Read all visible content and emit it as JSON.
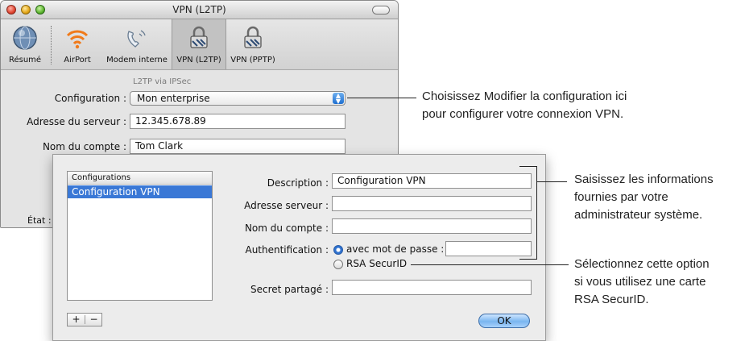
{
  "window": {
    "title": "VPN (L2TP)",
    "toolbar": [
      {
        "label": "Résumé",
        "icon": "globe-icon"
      },
      {
        "label": "AirPort",
        "icon": "airport-icon"
      },
      {
        "label": "Modem interne",
        "icon": "modem-icon"
      },
      {
        "label": "VPN (L2TP)",
        "icon": "lock-icon",
        "selected": true
      },
      {
        "label": "VPN (PPTP)",
        "icon": "lock-icon"
      }
    ],
    "sublabel": "L2TP via IPSec",
    "config_label": "Configuration :",
    "config_value": "Mon enterprise",
    "server_label": "Adresse du serveur :",
    "server_value": "12.345.678.89",
    "account_label": "Nom du compte :",
    "account_value": "Tom Clark",
    "status_label": "État :"
  },
  "sheet": {
    "list_header": "Configurations",
    "list_items": [
      "Configuration  VPN"
    ],
    "description_label": "Description :",
    "description_value": "Configuration  VPN",
    "server_label": "Adresse serveur :",
    "server_value": "",
    "account_label": "Nom du compte :",
    "account_value": "",
    "auth_label": "Authentification :",
    "auth_password_option": "avec mot de passe :",
    "auth_password_value": "",
    "auth_rsa_option": "RSA SecurID",
    "secret_label": "Secret partagé :",
    "secret_value": "",
    "add_label": "+",
    "remove_label": "−",
    "ok_label": "OK"
  },
  "callouts": {
    "config": [
      "Choisissez Modifier la configuration ici",
      "pour configurer votre connexion VPN."
    ],
    "fields": [
      "Saisissez les informations",
      "fournies par votre",
      "administrateur système."
    ],
    "rsa": [
      "Sélectionnez cette option",
      "si vous utilisez une carte",
      "RSA SecurID."
    ]
  },
  "colors": {
    "selection": "#3a78d6",
    "ok_button": "#7ab6f0",
    "window_bg": "#e8e8e8"
  }
}
